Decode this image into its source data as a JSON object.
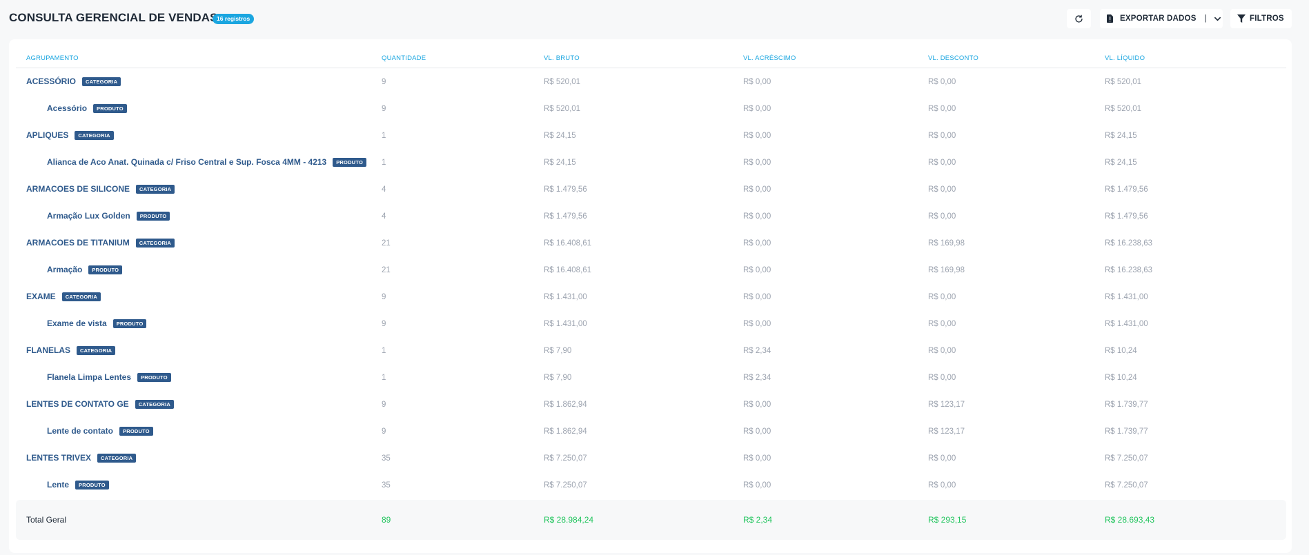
{
  "header": {
    "title": "CONSULTA GERENCIAL DE VENDAS",
    "count_badge": "16 registros",
    "export_label": "EXPORTAR DADOS",
    "export_separator": "|",
    "filter_label": "FILTROS"
  },
  "icons": {
    "refresh": "refresh-icon",
    "export": "file-export-icon",
    "chevron": "chevron-down-icon",
    "filter": "filter-icon"
  },
  "colors": {
    "accent": "#1ba6e0",
    "group": "#2f5a8c",
    "total": "#22c55e"
  },
  "table": {
    "columns": [
      "AGRUPAMENTO",
      "QUANTIDADE",
      "VL. BRUTO",
      "VL. ACRÉSCIMO",
      "VL. DESCONTO",
      "VL. LÍQUIDO"
    ],
    "rows": [
      {
        "name": "ACESSÓRIO",
        "tag": "CATEGORIA",
        "qty": "9",
        "bruto": "R$ 520,01",
        "acrescimo": "R$ 0,00",
        "desconto": "R$ 0,00",
        "liquido": "R$ 520,01"
      },
      {
        "name": "Acessório",
        "tag": "PRODUTO",
        "qty": "9",
        "bruto": "R$ 520,01",
        "acrescimo": "R$ 0,00",
        "desconto": "R$ 0,00",
        "liquido": "R$ 520,01"
      },
      {
        "name": "APLIQUES",
        "tag": "CATEGORIA",
        "qty": "1",
        "bruto": "R$ 24,15",
        "acrescimo": "R$ 0,00",
        "desconto": "R$ 0,00",
        "liquido": "R$ 24,15"
      },
      {
        "name": "Alianca de Aco Anat. Quinada c/ Friso Central e Sup. Fosca 4MM - 4213",
        "tag": "PRODUTO",
        "qty": "1",
        "bruto": "R$ 24,15",
        "acrescimo": "R$ 0,00",
        "desconto": "R$ 0,00",
        "liquido": "R$ 24,15"
      },
      {
        "name": "ARMACOES DE SILICONE",
        "tag": "CATEGORIA",
        "qty": "4",
        "bruto": "R$ 1.479,56",
        "acrescimo": "R$ 0,00",
        "desconto": "R$ 0,00",
        "liquido": "R$ 1.479,56"
      },
      {
        "name": "Armação Lux Golden",
        "tag": "PRODUTO",
        "qty": "4",
        "bruto": "R$ 1.479,56",
        "acrescimo": "R$ 0,00",
        "desconto": "R$ 0,00",
        "liquido": "R$ 1.479,56"
      },
      {
        "name": "ARMACOES DE TITANIUM",
        "tag": "CATEGORIA",
        "qty": "21",
        "bruto": "R$ 16.408,61",
        "acrescimo": "R$ 0,00",
        "desconto": "R$ 169,98",
        "liquido": "R$ 16.238,63"
      },
      {
        "name": "Armação",
        "tag": "PRODUTO",
        "qty": "21",
        "bruto": "R$ 16.408,61",
        "acrescimo": "R$ 0,00",
        "desconto": "R$ 169,98",
        "liquido": "R$ 16.238,63"
      },
      {
        "name": "EXAME",
        "tag": "CATEGORIA",
        "qty": "9",
        "bruto": "R$ 1.431,00",
        "acrescimo": "R$ 0,00",
        "desconto": "R$ 0,00",
        "liquido": "R$ 1.431,00"
      },
      {
        "name": "Exame de vista",
        "tag": "PRODUTO",
        "qty": "9",
        "bruto": "R$ 1.431,00",
        "acrescimo": "R$ 0,00",
        "desconto": "R$ 0,00",
        "liquido": "R$ 1.431,00"
      },
      {
        "name": "FLANELAS",
        "tag": "CATEGORIA",
        "qty": "1",
        "bruto": "R$ 7,90",
        "acrescimo": "R$ 2,34",
        "desconto": "R$ 0,00",
        "liquido": "R$ 10,24"
      },
      {
        "name": "Flanela Limpa Lentes",
        "tag": "PRODUTO",
        "qty": "1",
        "bruto": "R$ 7,90",
        "acrescimo": "R$ 2,34",
        "desconto": "R$ 0,00",
        "liquido": "R$ 10,24"
      },
      {
        "name": "LENTES DE CONTATO GE",
        "tag": "CATEGORIA",
        "qty": "9",
        "bruto": "R$ 1.862,94",
        "acrescimo": "R$ 0,00",
        "desconto": "R$ 123,17",
        "liquido": "R$ 1.739,77"
      },
      {
        "name": "Lente de contato",
        "tag": "PRODUTO",
        "qty": "9",
        "bruto": "R$ 1.862,94",
        "acrescimo": "R$ 0,00",
        "desconto": "R$ 123,17",
        "liquido": "R$ 1.739,77"
      },
      {
        "name": "LENTES TRIVEX",
        "tag": "CATEGORIA",
        "qty": "35",
        "bruto": "R$ 7.250,07",
        "acrescimo": "R$ 0,00",
        "desconto": "R$ 0,00",
        "liquido": "R$ 7.250,07"
      },
      {
        "name": "Lente",
        "tag": "PRODUTO",
        "qty": "35",
        "bruto": "R$ 7.250,07",
        "acrescimo": "R$ 0,00",
        "desconto": "R$ 0,00",
        "liquido": "R$ 7.250,07"
      }
    ],
    "total": {
      "label": "Total Geral",
      "qty": "89",
      "bruto": "R$ 28.984,24",
      "acrescimo": "R$ 2,34",
      "desconto": "R$ 293,15",
      "liquido": "R$ 28.693,43"
    }
  }
}
